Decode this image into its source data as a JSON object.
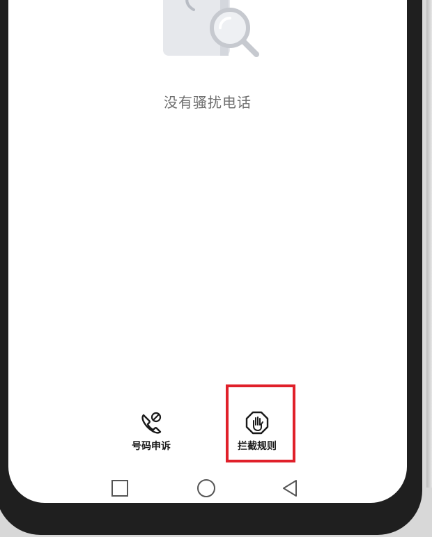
{
  "empty_state": {
    "message": "没有骚扰电话",
    "illustration_icon": "phone-search-icon"
  },
  "bottom_actions": [
    {
      "label": "号码申诉",
      "icon": "phone-blocked-icon"
    },
    {
      "label": "拦截规则",
      "icon": "hand-stop-icon",
      "highlighted": true
    }
  ],
  "navigation": {
    "recent": "square-icon",
    "home": "circle-icon",
    "back": "triangle-back-icon"
  },
  "colors": {
    "highlight": "#e0202a",
    "background": "#ffffff",
    "frame": "#1f1f1f"
  }
}
